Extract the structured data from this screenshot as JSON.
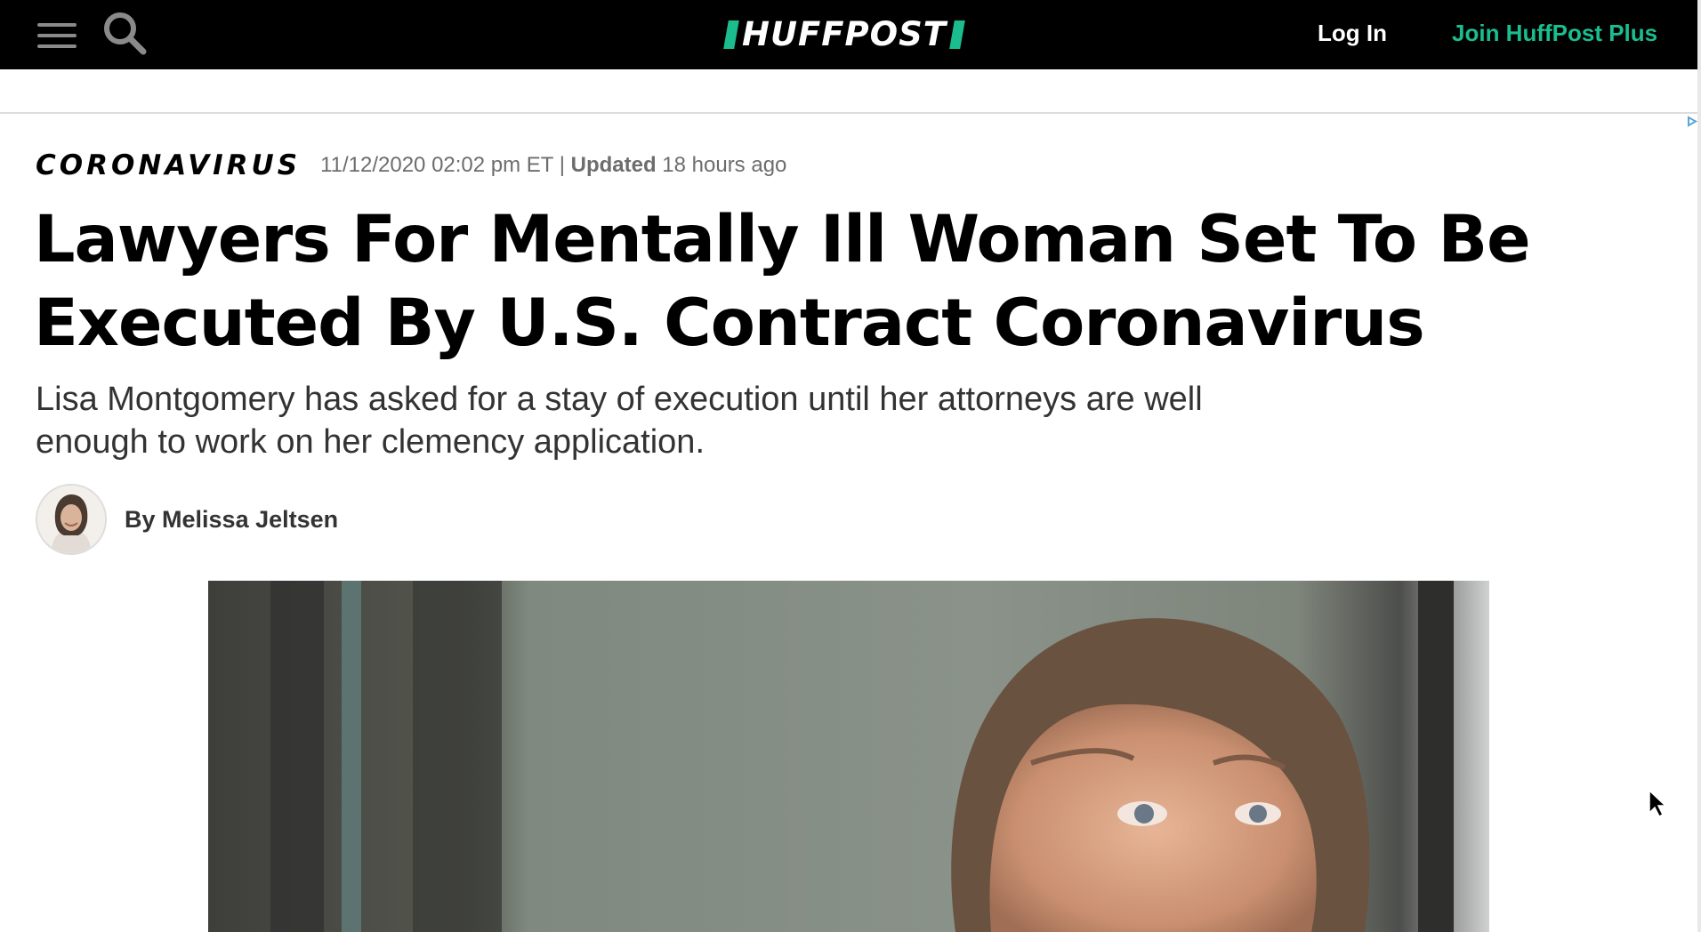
{
  "nav": {
    "menu_icon": "hamburger-menu-icon",
    "search_icon": "search-icon",
    "logo_text": "HUFFPOST",
    "login_label": "Log In",
    "join_label": "Join HuffPost Plus",
    "accent_color": "#1bbd8e",
    "background_color": "#000000"
  },
  "article": {
    "section": "CORONAVIRUS",
    "published": "11/12/2020 02:02 pm ET |",
    "updated_label": "Updated",
    "updated_value": "18 hours ago",
    "headline": "Lawyers For Mentally Ill Woman Set To Be Executed By U.S. Contract Coronavirus",
    "dek": "Lisa Montgomery has asked for a stay of execution until her attorneys are well enough to work on her clemency application.",
    "byline_prefix": "By",
    "author": "Melissa Jeltsen"
  }
}
